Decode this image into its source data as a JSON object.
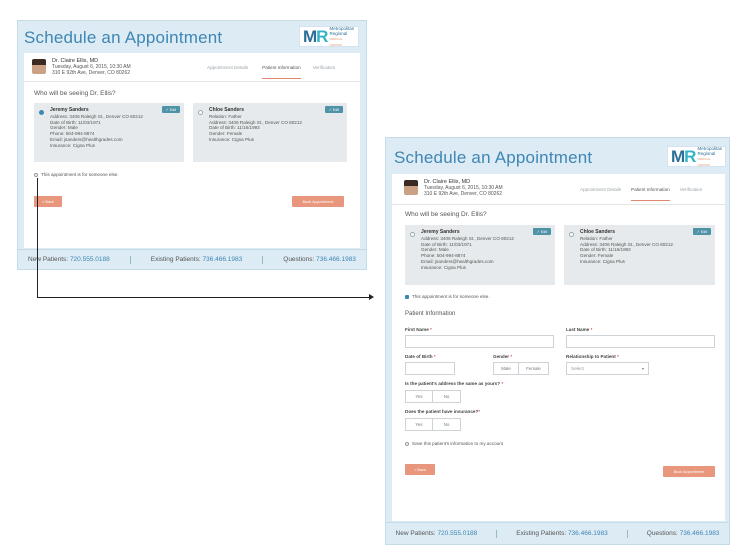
{
  "screen1": {
    "title": "Schedule an Appointment",
    "logo": {
      "mark_m": "M",
      "mark_r": "R",
      "line1": "Metropolitan",
      "line2": "Regional",
      "line3": "MEDICAL CENTER"
    },
    "doctor": {
      "name": "Dr. Claire Ellis, MD",
      "date": "Tuesday, August 6, 2015, 10:30 AM",
      "address": "310 E 92th Ave, Denver, CO 80262"
    },
    "steps": [
      "Appointment Details",
      "Patient Information",
      "Verification"
    ],
    "question": "Who will be seeing Dr. Ellis?",
    "patients": [
      {
        "name": "Jeremy Sanders",
        "lines": [
          "Address: 3406 Raleigh St., Denver CO 80212",
          "Date of Birth: 11/03/1971",
          "Gender: Male",
          "Phone: 504-994-8874",
          "Email: jsanders@healthgrades.com",
          "Insurance: Cigna Plus"
        ],
        "edit": "✓ Edit"
      },
      {
        "name": "Chloe Sanders",
        "lines": [
          "Relation: Father",
          "Address: 3406 Raleigh St., Denver CO 80212",
          "Date of Birth: 11/16/1993",
          "Gender: Female",
          "Insurance: Cigna Plus"
        ],
        "edit": "✓ Edit"
      }
    ],
    "someone_else": "This appointment is for someone else.",
    "back": "< Back",
    "book": "Book Appointment",
    "footer": {
      "new_label": "New Patients:",
      "new_num": "720.555.0188",
      "existing_label": "Existing Patients:",
      "existing_num": "736.466.1983",
      "questions_label": "Questions:",
      "questions_num": "736.466.1983"
    }
  },
  "screen2": {
    "title": "Schedule an Appointment",
    "logo": {
      "mark_m": "M",
      "mark_r": "R",
      "line1": "Metropolitan",
      "line2": "Regional",
      "line3": "MEDICAL CENTER"
    },
    "doctor": {
      "name": "Dr. Claire Ellis, MD",
      "date": "Tuesday, August 6, 2015, 10:30 AM",
      "address": "310 E 92th Ave, Denver, CO 80262"
    },
    "steps": [
      "Appointment Details",
      "Patient Information",
      "Verification"
    ],
    "question": "Who will be seeing Dr. Ellis?",
    "patients": [
      {
        "name": "Jeremy Sanders",
        "lines": [
          "Address: 3406 Raleigh St., Denver CO 80212",
          "Date of Birth: 11/03/1971",
          "Gender: Male",
          "Phone: 504-994-8874",
          "Email: jsanders@healthgrades.com",
          "Insurance: Cigna Plus"
        ],
        "edit": "✓ Edit"
      },
      {
        "name": "Chloe Sanders",
        "lines": [
          "Relation: Father",
          "Address: 3406 Raleigh St., Denver CO 80212",
          "Date of Birth: 11/16/1993",
          "Gender: Female",
          "Insurance: Cigna Plus"
        ],
        "edit": "✓ Edit"
      }
    ],
    "someone_else": "This appointment is for someone else.",
    "patient_info_heading": "Patient Information",
    "first_name_label": "First Name",
    "last_name_label": "Last Name",
    "dob_label": "Date of Birth",
    "gender_label": "Gender",
    "gender_options": [
      "Male",
      "Female"
    ],
    "relationship_label": "Relationship to Patient",
    "relationship_select": "Select",
    "same_address_label": "Is the patient's address the same as yours?",
    "insurance_label": "Does the patient have insurance?",
    "yes_no": [
      "Yes",
      "No"
    ],
    "required_mark": "*",
    "save_info": "Save this patient's information to my account",
    "back": "< Back",
    "book": "Book Appointment",
    "footer": {
      "new_label": "New Patients:",
      "new_num": "720.555.0188",
      "existing_label": "Existing Patients:",
      "existing_num": "736.466.1983",
      "questions_label": "Questions:",
      "questions_num": "736.466.1983"
    }
  }
}
